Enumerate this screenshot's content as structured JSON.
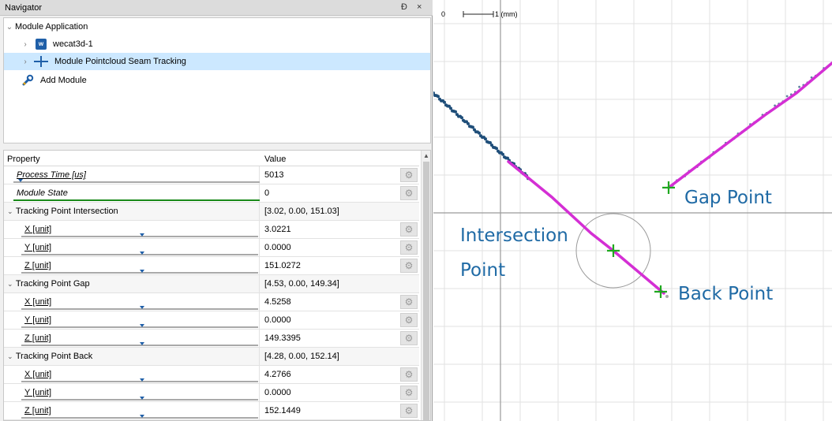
{
  "navigator": {
    "title": "Navigator",
    "float_btn": "Ɖ",
    "close_btn": "×",
    "tree": {
      "root": "Module Application",
      "device": "wecat3d-1",
      "module": "Module Pointcloud Seam Tracking",
      "add": "Add Module"
    }
  },
  "properties": {
    "header_property": "Property",
    "header_value": "Value",
    "rows": [
      {
        "name": "Process Time [us]",
        "value": "5013"
      },
      {
        "name": "Module State",
        "value": "0"
      },
      {
        "name": "Tracking Point Intersection",
        "value": "[3.02, 0.00, 151.03]"
      },
      {
        "name": "X [unit]",
        "value": "3.0221"
      },
      {
        "name": "Y [unit]",
        "value": "0.0000"
      },
      {
        "name": "Z [unit]",
        "value": "151.0272"
      },
      {
        "name": "Tracking Point Gap",
        "value": "[4.53, 0.00, 149.34]"
      },
      {
        "name": "X [unit]",
        "value": "4.5258"
      },
      {
        "name": "Y [unit]",
        "value": "0.0000"
      },
      {
        "name": "Z [unit]",
        "value": "149.3395"
      },
      {
        "name": "Tracking Point Back",
        "value": "[4.28, 0.00, 152.14]"
      },
      {
        "name": "X [unit]",
        "value": "4.2766"
      },
      {
        "name": "Y [unit]",
        "value": "0.0000"
      },
      {
        "name": "Z [unit]",
        "value": "152.1449"
      }
    ]
  },
  "view": {
    "scale_zero": "0",
    "scale_one": "1 (mm)",
    "label_intersection_1": "Intersection",
    "label_intersection_2": "Point",
    "label_gap": "Gap Point",
    "label_back": "Back Point"
  },
  "colors": {
    "point_cloud": "#1f4e79",
    "seam": "#d42fd4",
    "marker": "#1fa81f",
    "annotation": "#1f6aa5"
  }
}
